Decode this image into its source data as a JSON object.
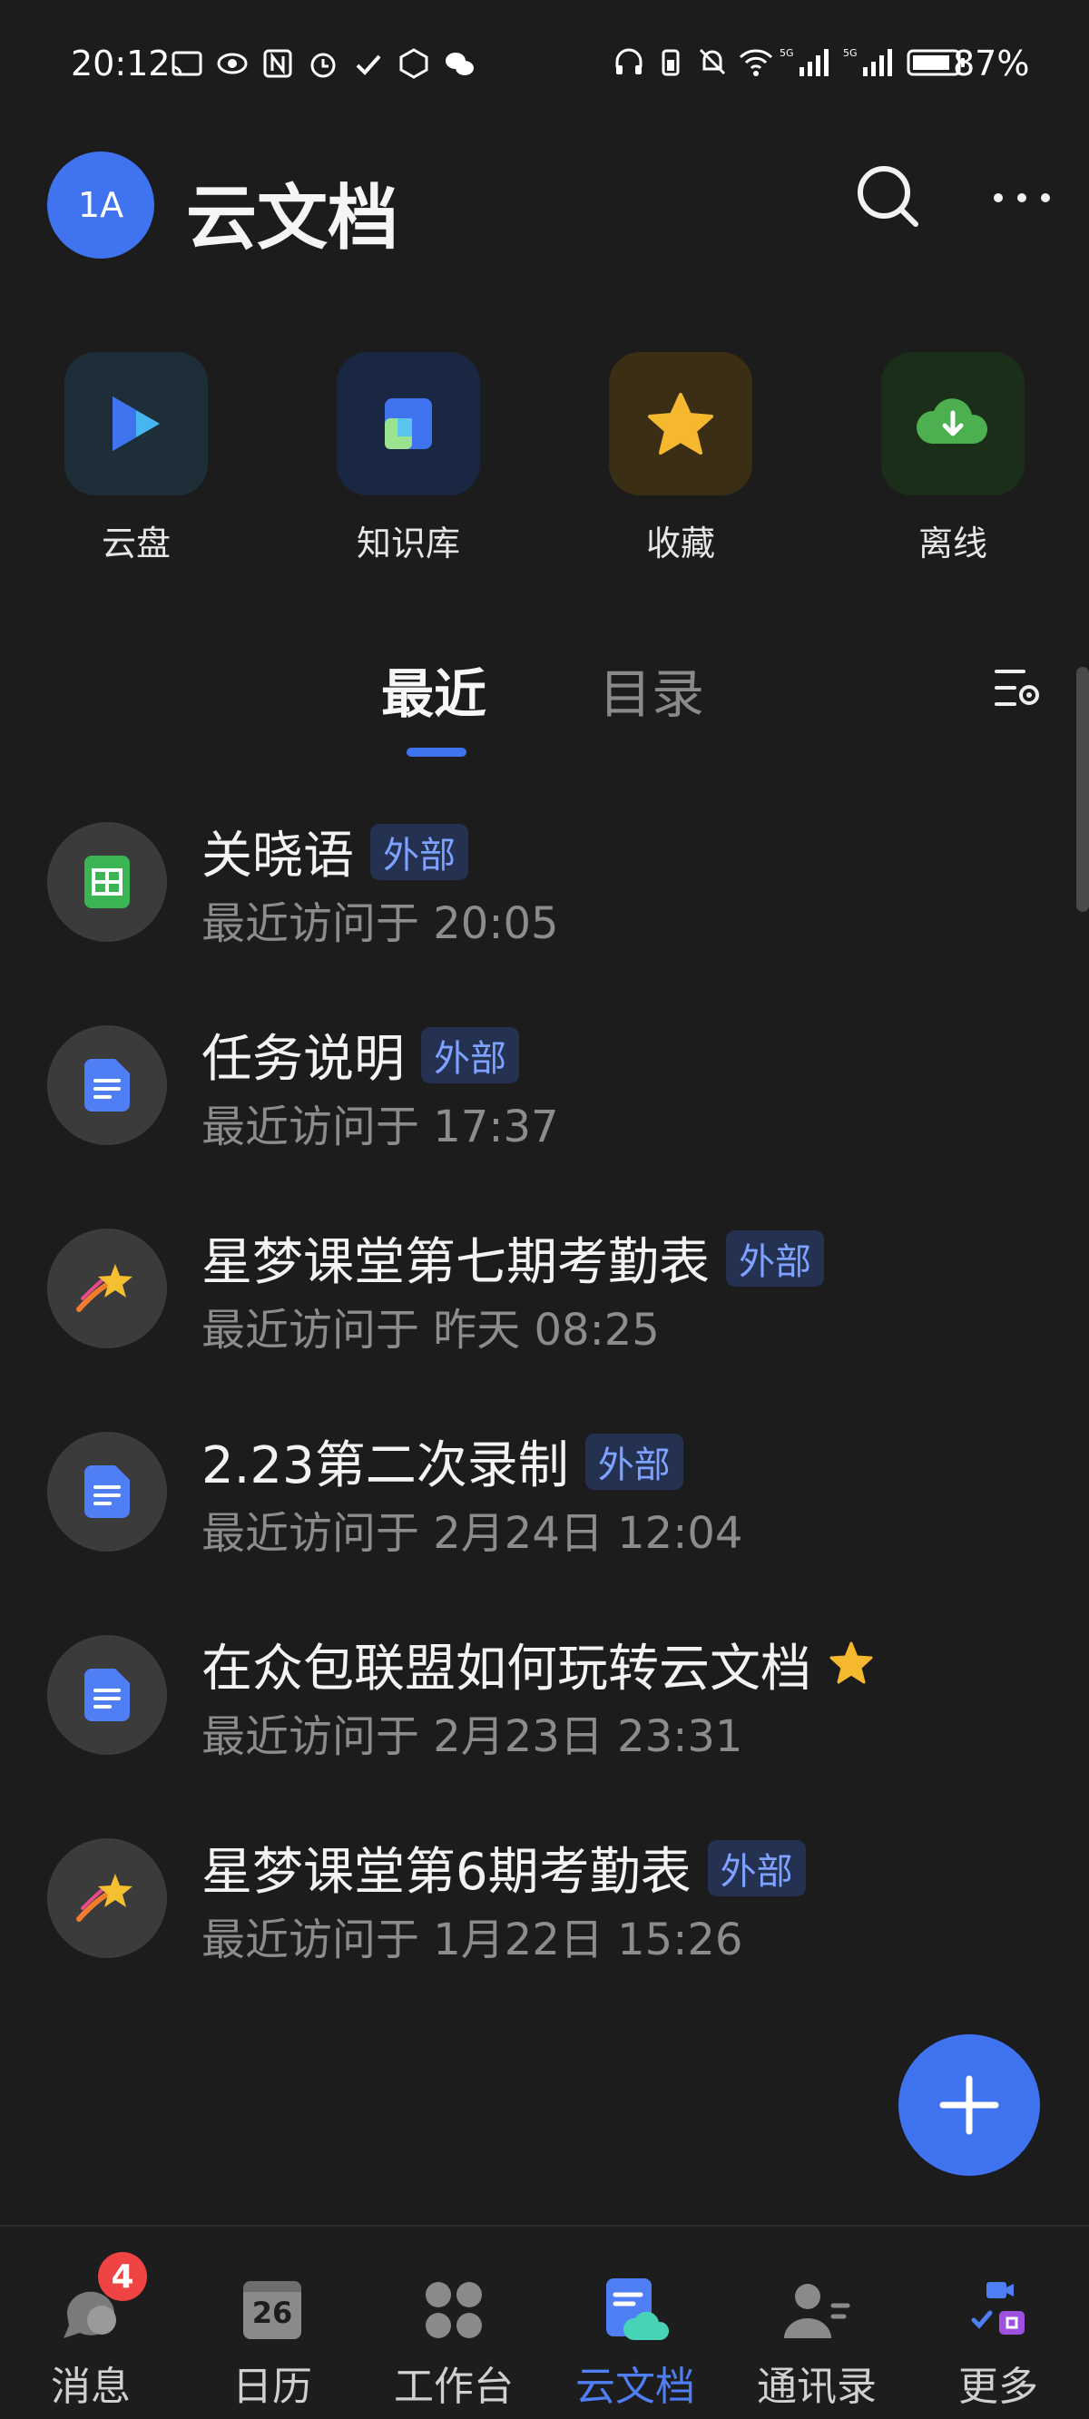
{
  "status_bar": {
    "time": "20:12",
    "battery": "87%"
  },
  "header": {
    "avatar_initials": "1A",
    "title": "云文档"
  },
  "quick_access": [
    {
      "label": "云盘",
      "icon": "cloud-disk-icon"
    },
    {
      "label": "知识库",
      "icon": "knowledge-base-icon"
    },
    {
      "label": "收藏",
      "icon": "star-icon"
    },
    {
      "label": "离线",
      "icon": "offline-download-icon"
    }
  ],
  "tabs": [
    {
      "label": "最近",
      "active": true
    },
    {
      "label": "目录",
      "active": false
    }
  ],
  "documents": [
    {
      "title": "关晓语",
      "badge": "外部",
      "subtitle": "最近访问于 20:05",
      "icon": "sheet-icon",
      "starred": false
    },
    {
      "title": "任务说明",
      "badge": "外部",
      "subtitle": "最近访问于 17:37",
      "icon": "doc-icon",
      "starred": false
    },
    {
      "title": "星梦课堂第七期考勤表",
      "badge": "外部",
      "subtitle": "最近访问于 昨天 08:25",
      "icon": "shooting-star-icon",
      "starred": false
    },
    {
      "title": "2.23第二次录制",
      "badge": "外部",
      "subtitle": "最近访问于  2月24日 12:04",
      "icon": "doc-icon",
      "starred": false
    },
    {
      "title": "在众包联盟如何玩转云文档",
      "badge": "",
      "subtitle": "最近访问于  2月23日 23:31",
      "icon": "doc-icon",
      "starred": true
    },
    {
      "title": "星梦课堂第6期考勤表",
      "badge": "外部",
      "subtitle": "最近访问于  1月22日 15:26",
      "icon": "shooting-star-icon",
      "starred": false
    }
  ],
  "bottom_nav": [
    {
      "label": "消息",
      "icon": "chat-bubble-icon",
      "badge": "4",
      "active": false
    },
    {
      "label": "日历",
      "icon": "calendar-icon",
      "calendar_day": "26",
      "active": false
    },
    {
      "label": "工作台",
      "icon": "workspace-grid-icon",
      "active": false
    },
    {
      "label": "云文档",
      "icon": "cloud-doc-icon",
      "active": true
    },
    {
      "label": "通讯录",
      "icon": "contacts-icon",
      "active": false
    },
    {
      "label": "更多",
      "icon": "more-apps-icon",
      "active": false
    }
  ],
  "colors": {
    "background": "#1c1c1c",
    "accent": "#3f73f0",
    "badge_text": "#7ea2ff",
    "star": "#f5b82e"
  }
}
